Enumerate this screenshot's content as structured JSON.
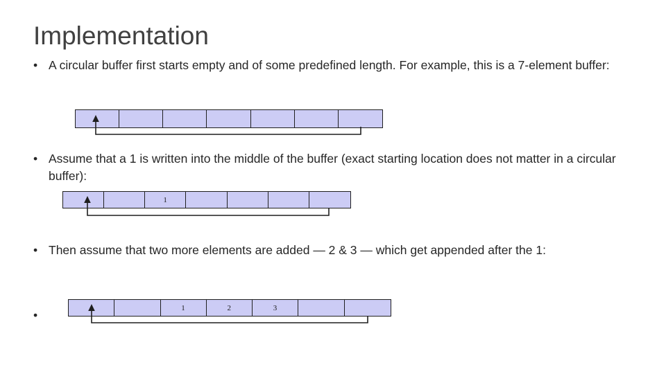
{
  "slide": {
    "title": "Implementation",
    "bullets": [
      {
        "marker": "•",
        "text": "A circular buffer first starts empty and of some predefined length. For example, this is a 7-element buffer:"
      },
      {
        "marker": "•",
        "text": "Assume that a 1 is written into the middle of the buffer (exact starting location does not matter in a circular buffer):"
      },
      {
        "marker": "•",
        "text": "Then assume that two more elements are added — 2 & 3 — which get appended after the 1:"
      },
      {
        "marker": "•",
        "text": ""
      }
    ],
    "diagrams": [
      {
        "name": "empty-buffer",
        "cells": [
          "",
          "",
          "",
          "",
          "",
          "",
          ""
        ],
        "pointer_cell_index": 0,
        "tail_cell_index": 6
      },
      {
        "name": "buffer-with-one-element",
        "cells": [
          "",
          "",
          "1",
          "",
          "",
          "",
          ""
        ],
        "pointer_cell_index": 0,
        "tail_cell_index": 6
      },
      {
        "name": "buffer-with-three-elements",
        "cells": [
          "",
          "",
          "1",
          "2",
          "3",
          "",
          ""
        ],
        "pointer_cell_index": 0,
        "tail_cell_index": 6
      }
    ],
    "colors": {
      "cell_fill": "#ccccf5",
      "cell_border": "#1f1f1f",
      "title_text": "#404040",
      "body_text": "#262626",
      "background": "#ffffff"
    }
  }
}
